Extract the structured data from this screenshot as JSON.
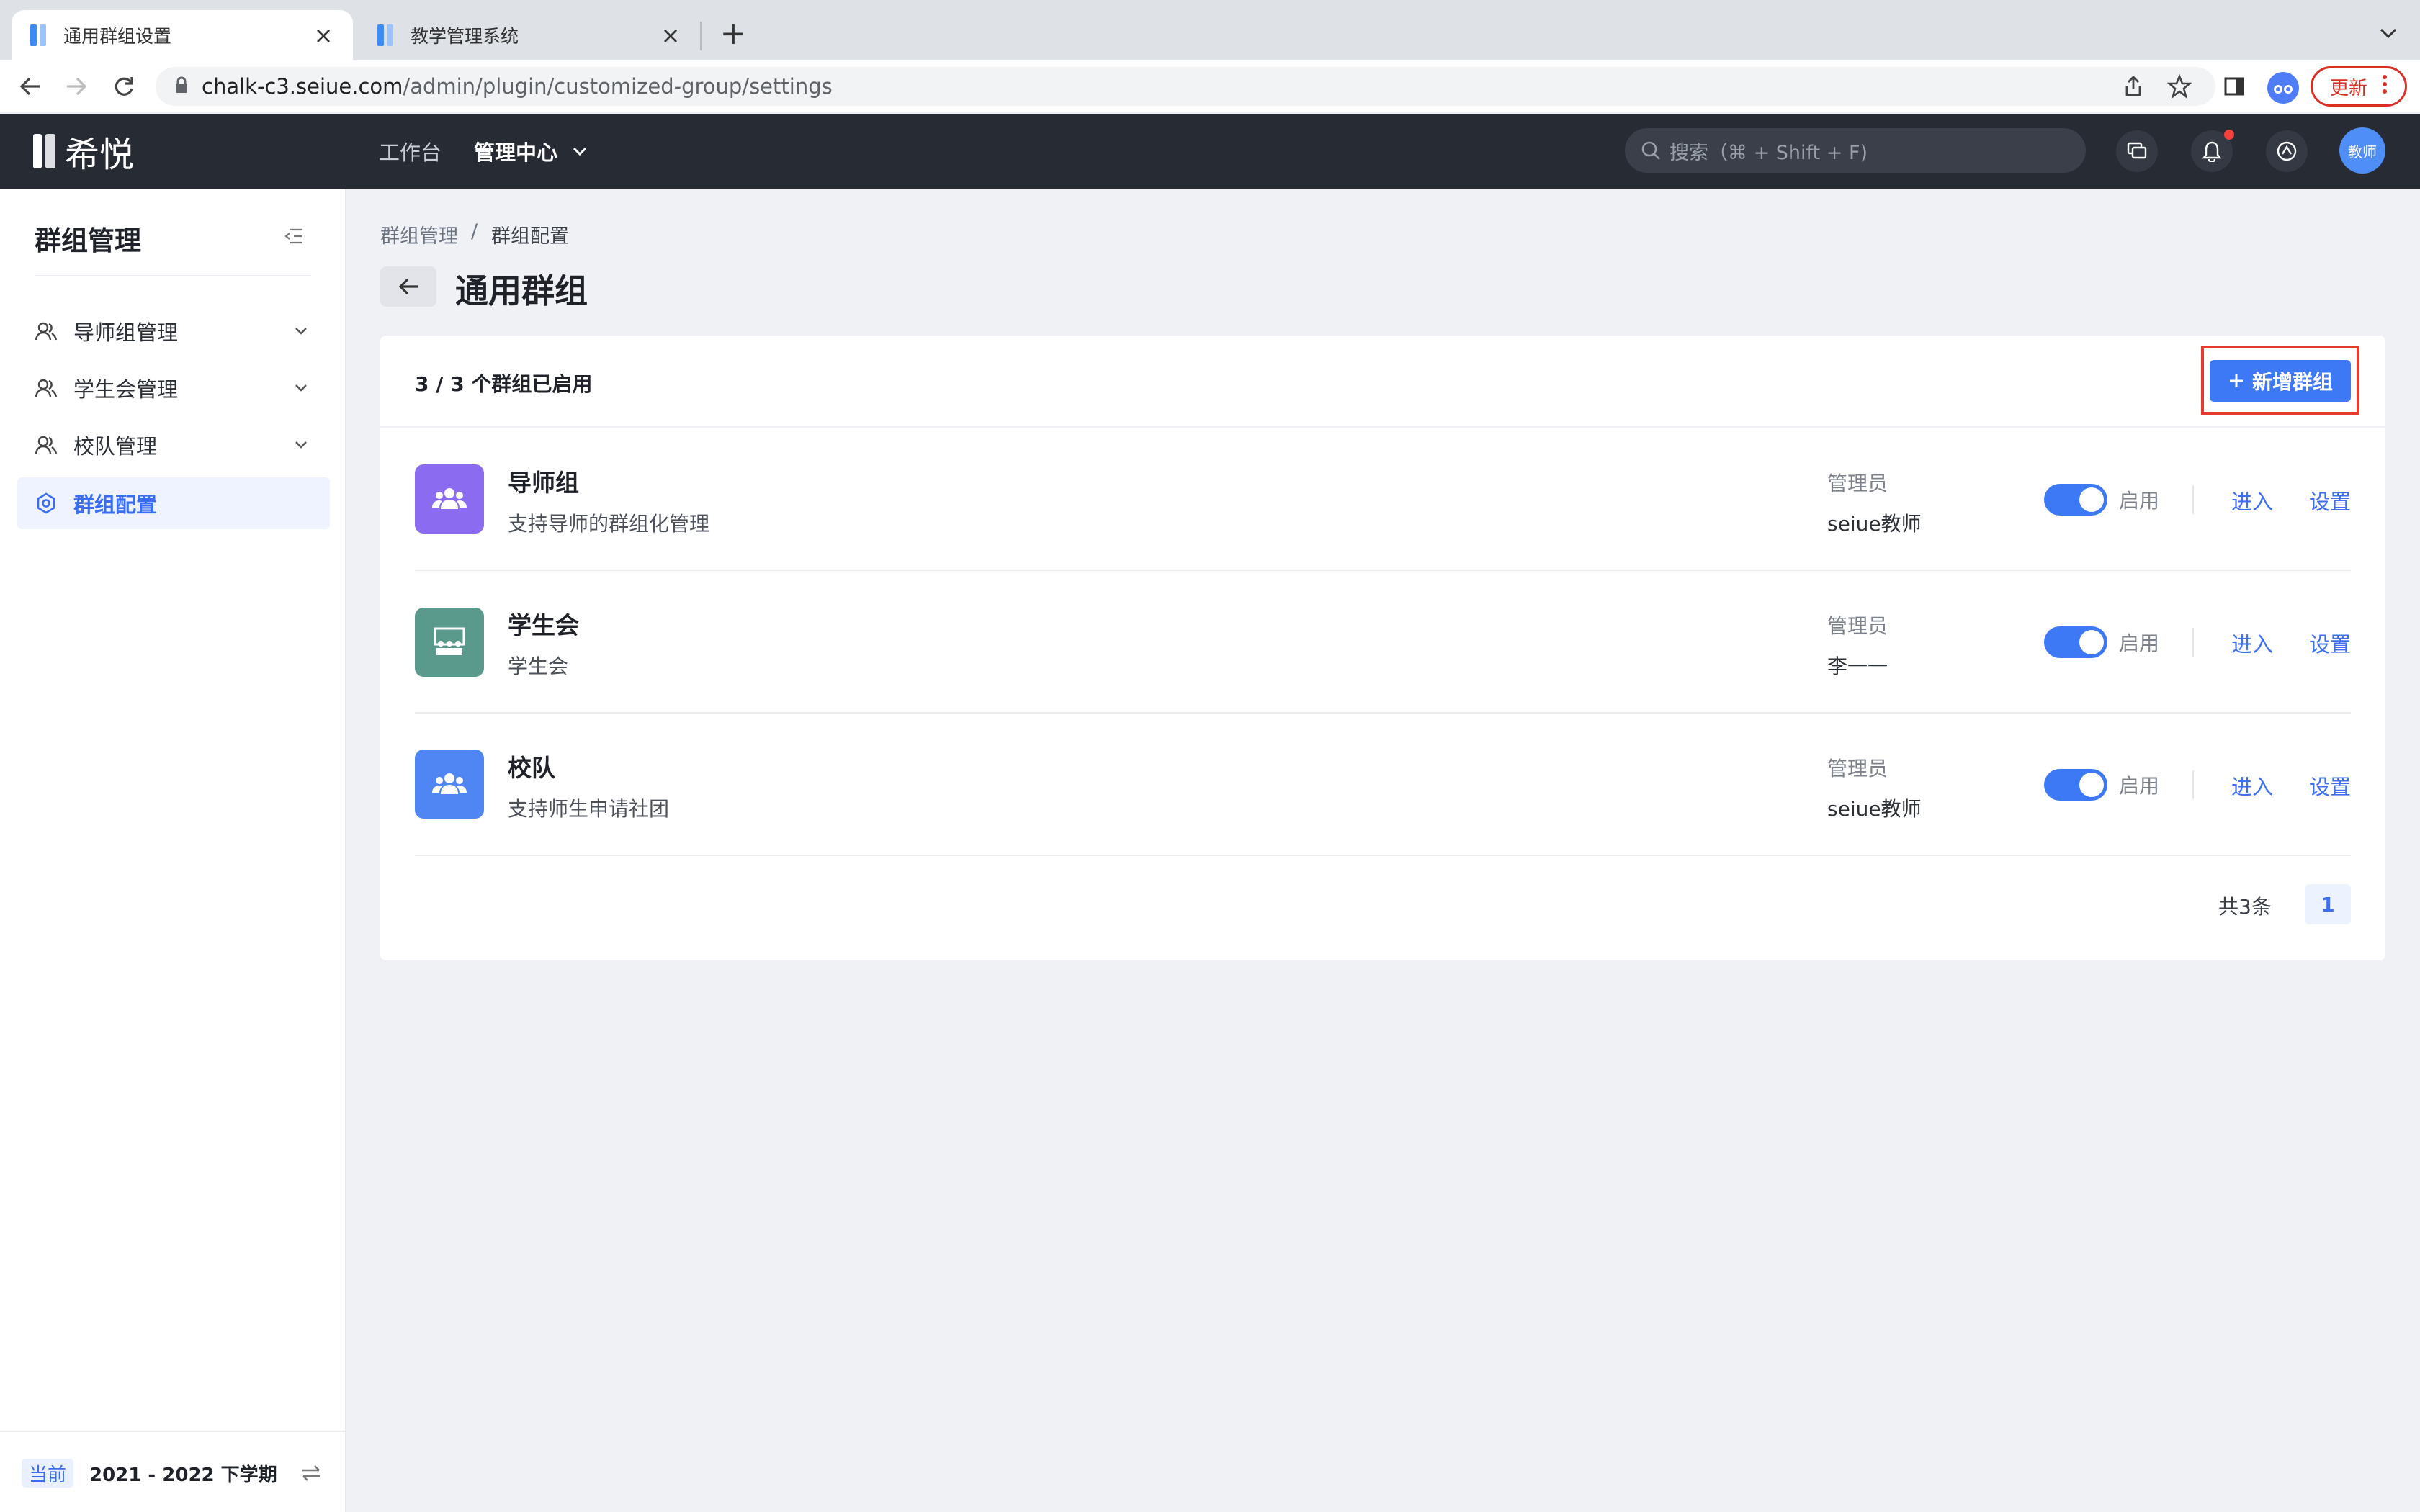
{
  "browser": {
    "tabs": [
      {
        "title": "通用群组设置",
        "active": true
      },
      {
        "title": "教学管理系统",
        "active": false
      }
    ],
    "url_host": "chalk-c3.seiue.com",
    "url_path": "/admin/plugin/customized-group/settings",
    "update_label": "更新"
  },
  "header": {
    "logo_text": "希悦",
    "nav": [
      {
        "label": "工作台"
      },
      {
        "label": "管理中心"
      }
    ],
    "search_placeholder": "搜索（⌘ + Shift + F)",
    "avatar_label": "教师"
  },
  "sidebar": {
    "title": "群组管理",
    "items": [
      {
        "label": "导师组管理",
        "icon": "users-icon"
      },
      {
        "label": "学生会管理",
        "icon": "users-icon"
      },
      {
        "label": "校队管理",
        "icon": "users-icon"
      },
      {
        "label": "群组配置",
        "icon": "gear-icon",
        "active": true
      }
    ],
    "term_badge": "当前",
    "term_text": "2021 - 2022 下学期"
  },
  "breadcrumb": [
    {
      "label": "群组管理"
    },
    {
      "label": "/"
    },
    {
      "label": "群组配置"
    }
  ],
  "page": {
    "title": "通用群组",
    "enabled_count": "3 / 3 个群组已启用",
    "add_button": "新增群组"
  },
  "groups": [
    {
      "name": "导师组",
      "desc": "支持导师的群组化管理",
      "admin_label": "管理员",
      "admin": "seiue教师",
      "enabled": true,
      "toggle_label": "启用",
      "enter_label": "进入",
      "settings_label": "设置",
      "icon_color": "#8b6cf0",
      "icon": "group-people-icon"
    },
    {
      "name": "学生会",
      "desc": "学生会",
      "admin_label": "管理员",
      "admin": "李一一",
      "enabled": true,
      "toggle_label": "启用",
      "enter_label": "进入",
      "settings_label": "设置",
      "icon_color": "#5a9a8d",
      "icon": "classroom-icon"
    },
    {
      "name": "校队",
      "desc": "支持师生申请社团",
      "admin_label": "管理员",
      "admin": "seiue教师",
      "enabled": true,
      "toggle_label": "启用",
      "enter_label": "进入",
      "settings_label": "设置",
      "icon_color": "#4f86f4",
      "icon": "group-people-icon"
    }
  ],
  "pagination": {
    "total": "共3条",
    "current": "1"
  },
  "colors": {
    "accent": "#3d78f5",
    "header_bg": "#272b34",
    "highlight": "#e53a2e"
  }
}
